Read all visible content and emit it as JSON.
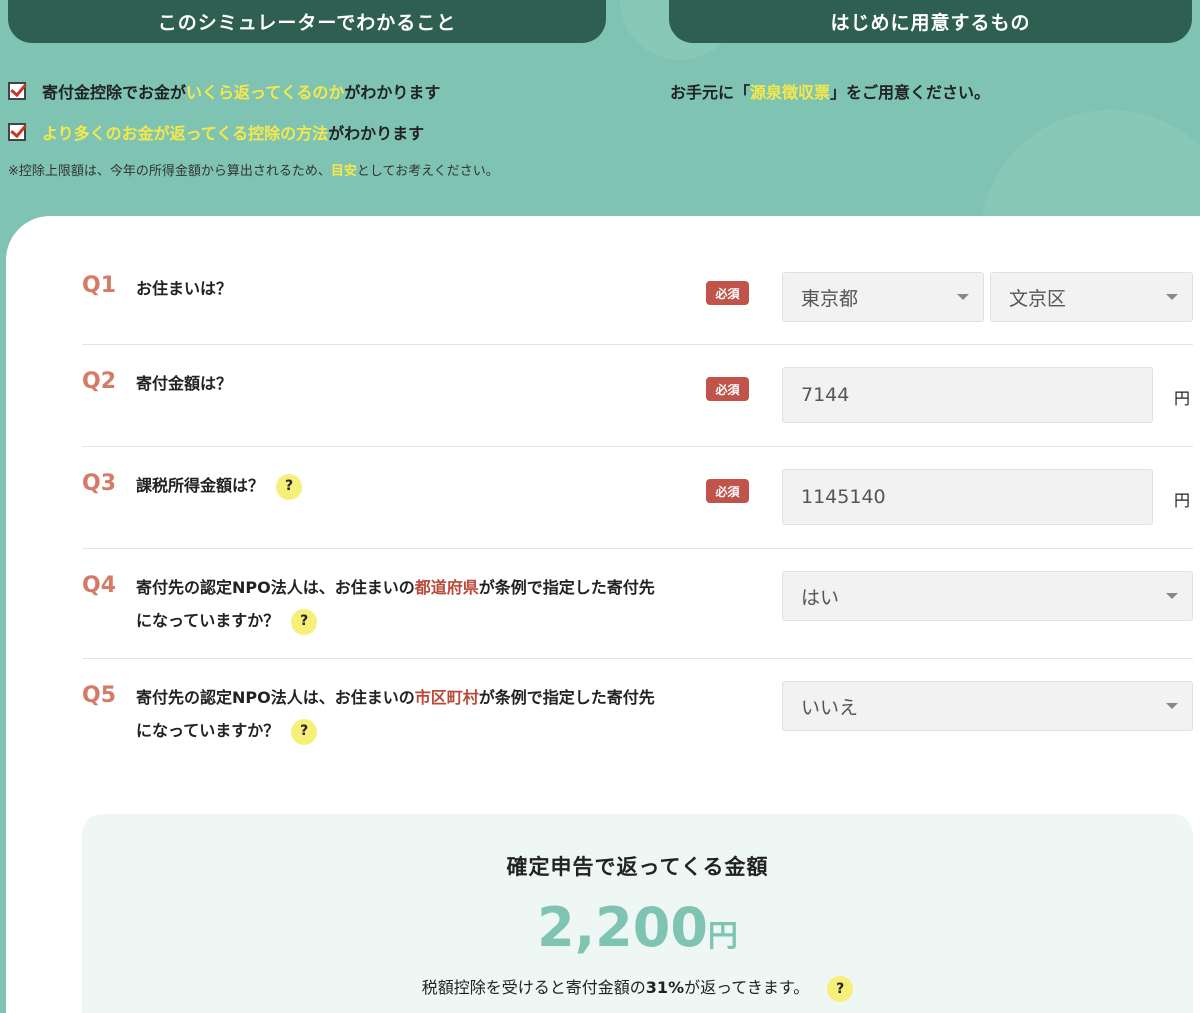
{
  "header": {
    "left_pill": "このシミュレーターでわかること",
    "right_pill": "はじめに用意するもの"
  },
  "checks": [
    {
      "pre": "寄付金控除でお金が",
      "highlight": "いくら返ってくるのか",
      "post": "がわかります"
    },
    {
      "pre": "",
      "highlight": "より多くのお金が返ってくる控除の方法",
      "post": "がわかります"
    }
  ],
  "note": {
    "pre": "※控除上限額は、今年の所得金額から算出されるため、",
    "highlight": "目安",
    "post": "としてお考えください。"
  },
  "prepare": {
    "pre": "お手元に「",
    "highlight": "源泉徴収票",
    "post": "」をご用意ください。"
  },
  "required_label": "必須",
  "help_label": "?",
  "questions": {
    "q1": {
      "label": "Q1",
      "text": "お住まいは？",
      "prefecture": "東京都",
      "city": "文京区"
    },
    "q2": {
      "label": "Q2",
      "text": "寄付金額は？",
      "value": "7144",
      "unit": "円"
    },
    "q3": {
      "label": "Q3",
      "text": "課税所得金額は？",
      "value": "1145140",
      "unit": "円"
    },
    "q4": {
      "label": "Q4",
      "pre": "寄付先の認定NPO法人は、お住まいの",
      "highlight": "都道府県",
      "post": "が条例で指定した寄付先",
      "line2": "になっていますか？",
      "value": "はい"
    },
    "q5": {
      "label": "Q5",
      "pre": "寄付先の認定NPO法人は、お住まいの",
      "highlight": "市区町村",
      "post": "が条例で指定した寄付先",
      "line2": "になっていますか？",
      "value": "いいえ"
    }
  },
  "result": {
    "title": "確定申告で返ってくる金額",
    "amount": "2,200",
    "unit": "円",
    "desc_pre": "税額控除を受けると寄付金額の",
    "desc_pct": "31%",
    "desc_post": "が返ってきます。"
  },
  "colors": {
    "primary": "#7fc4b2",
    "dark": "#2e5f50",
    "accent_red": "#c0534a",
    "highlight_yellow": "#f6e84a"
  }
}
